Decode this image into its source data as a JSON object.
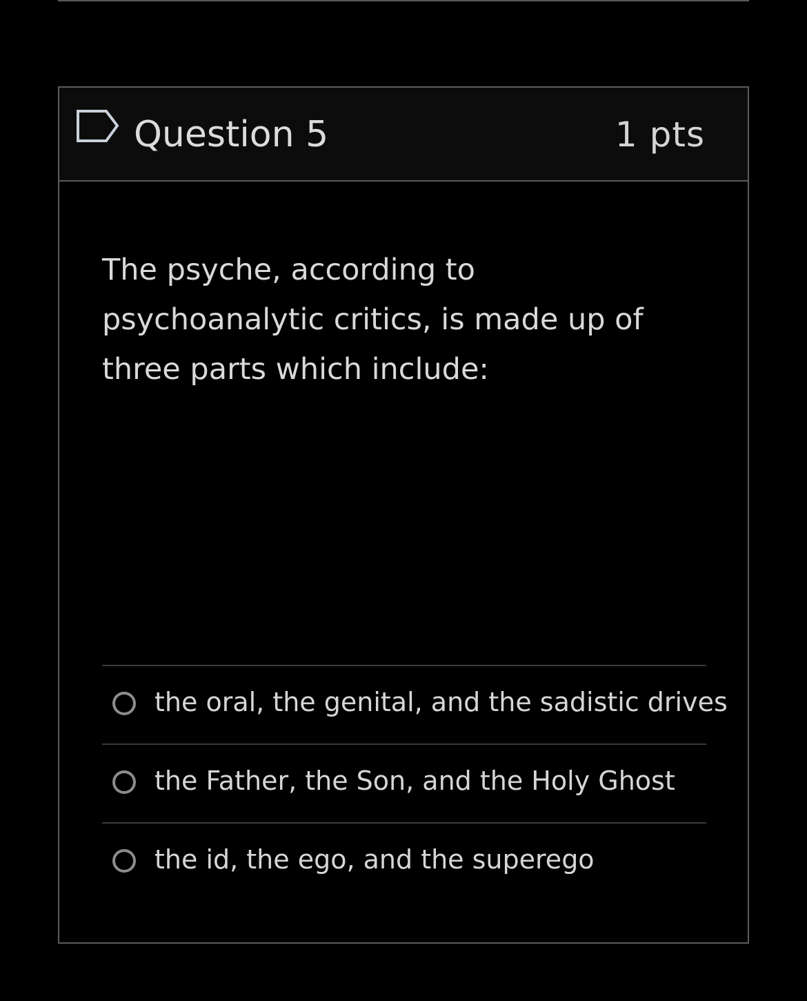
{
  "question": {
    "title": "Question 5",
    "points": "1 pts",
    "text": "The psyche, according to psychoanalytic critics, is made up of three parts which include:",
    "answers": [
      {
        "label": "the oral, the genital, and the sadistic drives"
      },
      {
        "label": "the Father, the Son, and the Holy Ghost"
      },
      {
        "label": "the id, the ego, and the superego"
      }
    ]
  },
  "icons": {
    "flag": "flag-outline-icon",
    "radio": "radio-unchecked-icon"
  },
  "colors": {
    "background": "#000000",
    "header_background": "#0c0c0c",
    "border": "#5c5c5c",
    "text": "#d9d9d9"
  }
}
